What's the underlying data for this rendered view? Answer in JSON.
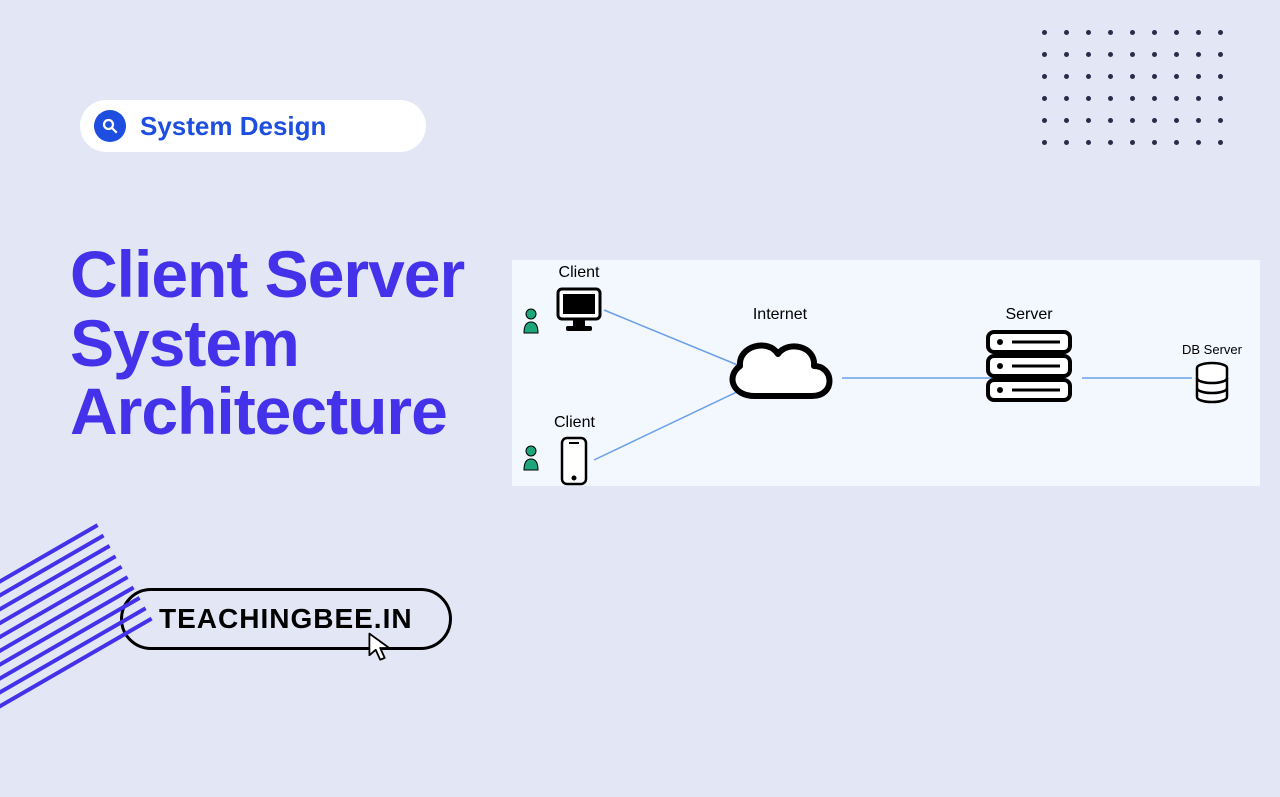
{
  "badge": {
    "label": "System Design"
  },
  "title": "Client Server\nSystem\nArchitecture",
  "site": "TEACHINGBEE.IN",
  "diagram": {
    "client1": "Client",
    "client2": "Client",
    "cloud": "Internet",
    "server": "Server",
    "db": "DB Server"
  }
}
